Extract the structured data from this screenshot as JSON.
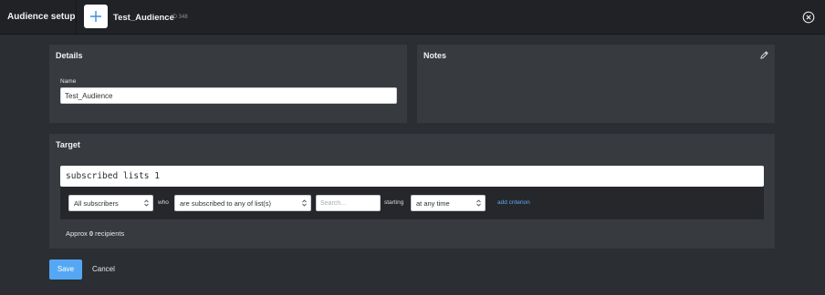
{
  "header": {
    "title": "Audience setup",
    "audience_name": "Test_Audience",
    "audience_id": "ID 348"
  },
  "details": {
    "title": "Details",
    "name_label": "Name",
    "name_value": "Test_Audience"
  },
  "notes": {
    "title": "Notes"
  },
  "target": {
    "title": "Target",
    "query": "subscribed lists 1",
    "criteria": {
      "subscribers_select": "All subscribers",
      "who_label": "who",
      "mode_select": "are subscribed to any of list(s)",
      "search_placeholder": "Search...",
      "starting_label": "starting",
      "time_select": "at any time",
      "add_criterion": "add criterion"
    },
    "approx_prefix": "Approx",
    "approx_count": "0",
    "approx_suffix": "recipients"
  },
  "actions": {
    "save": "Save",
    "cancel": "Cancel"
  },
  "colors": {
    "accent": "#55a7f3",
    "link": "#5ea9f5"
  }
}
